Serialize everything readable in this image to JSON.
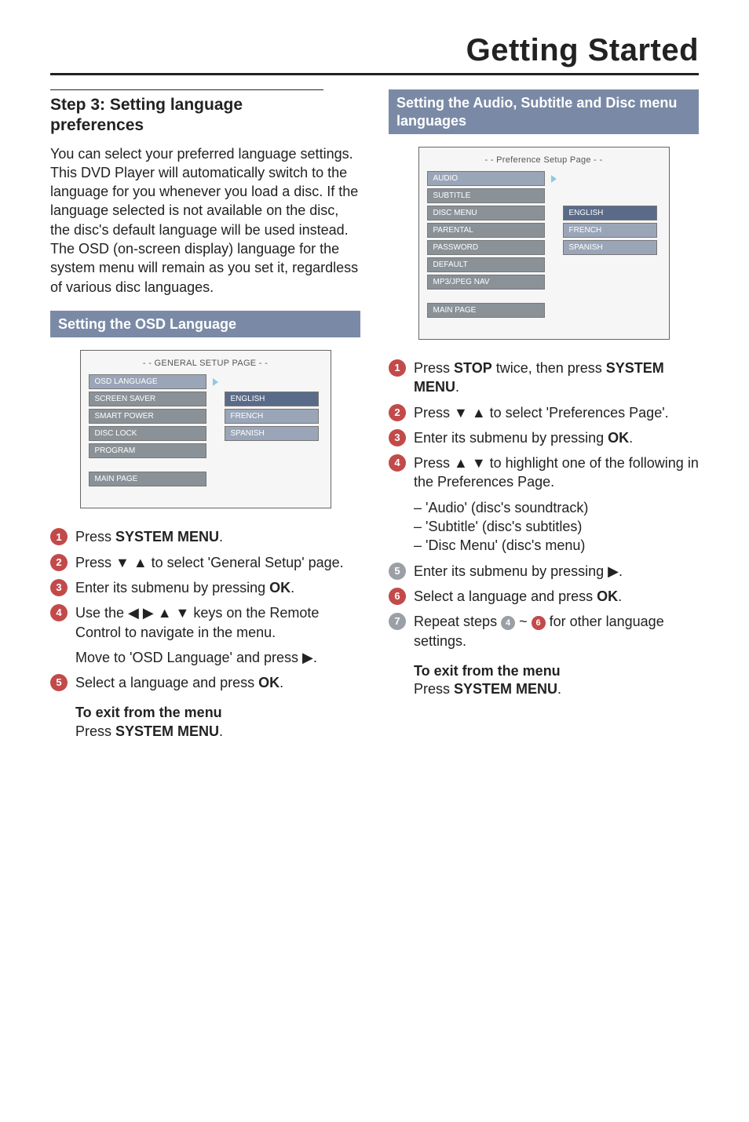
{
  "page_title": "Getting Started",
  "left": {
    "section_heading_l1": "Step 3:  Setting language",
    "section_heading_l2": "preferences",
    "intro_para": "You can select your preferred language settings. This DVD Player will automatically switch to the language for you whenever you load a disc.  If the language selected is not available on the disc, the disc's default language will be used instead.  The OSD (on-screen display) language for the system menu will remain as you set it, regardless of various disc languages.",
    "blue_heading": "Setting the OSD Language",
    "osd_panel": {
      "title": "- - GENERAL SETUP PAGE - -",
      "left_items": [
        "OSD LANGUAGE",
        "SCREEN SAVER",
        "SMART POWER",
        "DISC LOCK",
        "PROGRAM"
      ],
      "right_items": [
        "ENGLISH",
        "FRENCH",
        "SPANISH"
      ],
      "main_page": "MAIN PAGE"
    },
    "steps": [
      {
        "n": "1",
        "html": "Press <b>SYSTEM MENU</b>."
      },
      {
        "n": "2",
        "html": "Press ▼ ▲ to select 'General Setup' page."
      },
      {
        "n": "3",
        "html": "Enter its submenu by pressing <b>OK</b>."
      },
      {
        "n": "4",
        "html": "Use the ◀ ▶ ▲ ▼ keys on the Remote Control to navigate in the menu."
      },
      {
        "plain": "Move to 'OSD Language' and press ▶."
      },
      {
        "n": "5",
        "html": "Select a language and press <b>OK</b>."
      }
    ],
    "exit_bold": "To exit from the menu",
    "exit_line": "Press <b>SYSTEM MENU</b>."
  },
  "right": {
    "blue_heading": "Setting the Audio, Subtitle and Disc menu languages",
    "osd_panel": {
      "title": "- - Preference Setup Page - -",
      "left_items": [
        "AUDIO",
        "SUBTITLE",
        "DISC MENU",
        "PARENTAL",
        "PASSWORD",
        "DEFAULT",
        "MP3/JPEG NAV"
      ],
      "right_items": [
        "ENGLISH",
        "FRENCH",
        "SPANISH"
      ],
      "main_page": "MAIN PAGE"
    },
    "steps_a": [
      {
        "n": "1",
        "html": "Press <b>STOP</b> twice, then press <b>SYSTEM MENU</b>."
      },
      {
        "n": "2",
        "html": "Press ▼ ▲ to select 'Preferences Page'."
      },
      {
        "n": "3",
        "html": "Enter its submenu by pressing <b>OK</b>."
      },
      {
        "n": "4",
        "html": "Press ▲ ▼ to highlight one of the following in the Preferences Page."
      }
    ],
    "dash_items": [
      "'Audio' (disc's soundtrack)",
      "'Subtitle' (disc's subtitles)",
      "'Disc Menu' (disc's menu)"
    ],
    "steps_b": [
      {
        "n": "5",
        "grey": true,
        "html": "Enter its submenu by pressing ▶."
      },
      {
        "n": "6",
        "html": "Select a language and press <b>OK</b>."
      },
      {
        "n": "7",
        "grey": true,
        "html": "Repeat steps <span class=\"bullet-circle grey\" style=\"display:inline-flex;width:18px;height:18px;font-size:11px;vertical-align:middle;\">4</span> ~ <span class=\"bullet-circle\" style=\"display:inline-flex;width:18px;height:18px;font-size:11px;vertical-align:middle;\">6</span> for other language settings."
      }
    ],
    "exit_bold": "To exit from the menu",
    "exit_line": "Press <b>SYSTEM MENU</b>."
  }
}
